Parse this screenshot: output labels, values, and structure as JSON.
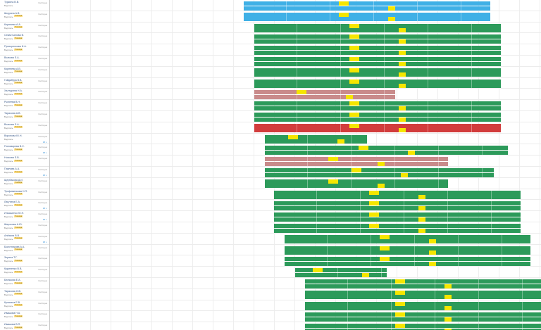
{
  "rows": [
    {
      "name": "Туркина В.В.",
      "sub": "Водитель",
      "badge": "",
      "status": "Свободна",
      "pct": "",
      "color": "blue"
    },
    {
      "name": "Шкурина А.В.",
      "sub": "Водитель",
      "badge": "Ученица",
      "status": "Свободна",
      "pct": "",
      "color": "blue"
    },
    {
      "name": "Корнеева А.А.",
      "sub": "Водитель",
      "badge": "Ученица",
      "status": "Свободна",
      "pct": "",
      "color": "green"
    },
    {
      "name": "Севастьянова В.",
      "sub": "Водитель",
      "badge": "Ученица",
      "status": "Свободна",
      "pct": "",
      "color": "green"
    },
    {
      "name": "Прохоренкова И.А.",
      "sub": "Водитель",
      "badge": "Ученица",
      "status": "Свободна",
      "pct": "",
      "color": "green"
    },
    {
      "name": "Волкова Е.А.",
      "sub": "Водитель",
      "badge": "Ученица",
      "status": "Свободна",
      "pct": "",
      "color": "green"
    },
    {
      "name": "Корнеева А.В.",
      "sub": "Водитель",
      "badge": "Ученица",
      "status": "Свободна",
      "pct": "",
      "color": "green"
    },
    {
      "name": "Гайдабура В.В.",
      "sub": "Водитель",
      "badge": "Ученица",
      "status": "Свободна",
      "pct": "",
      "color": "green"
    },
    {
      "name": "Халтурина Н.А.",
      "sub": "Водитель",
      "badge": "Ученица",
      "status": "Свободна",
      "pct": "",
      "color": "pink"
    },
    {
      "name": "Рылеева В.Н.",
      "sub": "Водитель",
      "badge": "Ученица",
      "status": "Свободна",
      "pct": "",
      "color": "green"
    },
    {
      "name": "Тарасова А.В.",
      "sub": "Водитель",
      "badge": "Ученица",
      "status": "Свободна",
      "pct": "",
      "color": "green"
    },
    {
      "name": "Волкова Л.А.",
      "sub": "Водитель",
      "badge": "Ученица",
      "status": "Свободна",
      "pct": "",
      "color": "red"
    },
    {
      "name": "Воронова Ю.Н.",
      "sub": "Водитель",
      "badge": "",
      "status": "Свободна",
      "pct": "48 ч.",
      "color": "green"
    },
    {
      "name": "Пономарева В.С.",
      "sub": "Водитель",
      "badge": "Ученица",
      "status": "Свободна",
      "pct": "48 ч.",
      "color": "green"
    },
    {
      "name": "Носкова Е.В.",
      "sub": "Водитель",
      "badge": "Ученица",
      "status": "Свободна",
      "pct": "",
      "color": "pink"
    },
    {
      "name": "Павлова А.А.",
      "sub": "Водитель",
      "badge": "Ученица",
      "status": "Свободна",
      "pct": "48 ч.",
      "color": "green"
    },
    {
      "name": "Щербакова Д.И.",
      "sub": "Водитель",
      "badge": "Ученица",
      "status": "Свободна",
      "pct": "",
      "color": "green"
    },
    {
      "name": "Трофименкова Н.П.",
      "sub": "Водитель",
      "badge": "Ученица",
      "status": "Свободна",
      "pct": "",
      "color": "green"
    },
    {
      "name": "Лагутина Е.А.",
      "sub": "Водитель",
      "badge": "Ученица",
      "status": "Свободна",
      "pct": "48 ч.",
      "color": "green"
    },
    {
      "name": "Ильяшенко Ю.Н.",
      "sub": "Водитель",
      "badge": "Ученица",
      "status": "Свободна",
      "pct": "48 ч.",
      "color": "green"
    },
    {
      "name": "Широкова А.Ю.",
      "sub": "Водитель",
      "badge": "Ученица",
      "status": "Свободна",
      "pct": "",
      "color": "green"
    },
    {
      "name": "Алёхина В.В.",
      "sub": "Водитель",
      "badge": "Ученица",
      "status": "Свободна",
      "pct": "48 ч.",
      "color": "green"
    },
    {
      "name": "Болотникова А.А.",
      "sub": "Водитель",
      "badge": "Ученица",
      "status": "Свободна",
      "pct": "",
      "color": "green"
    },
    {
      "name": "Зерина Т.Г.",
      "sub": "Водитель",
      "badge": "Ученица",
      "status": "Свободна",
      "pct": "",
      "color": "green"
    },
    {
      "name": "Куриленко В.В.",
      "sub": "Водитель",
      "badge": "Ученица",
      "status": "Свободна",
      "pct": "",
      "color": "green"
    },
    {
      "name": "Белякова Е.А.",
      "sub": "Водитель",
      "badge": "Ученица",
      "status": "Свободна",
      "pct": "",
      "color": "green"
    },
    {
      "name": "Тарасова О.В.",
      "sub": "Водитель",
      "badge": "Ученица",
      "status": "Свободна",
      "pct": "",
      "color": "green"
    },
    {
      "name": "Кулагина Е.В.",
      "sub": "Водитель",
      "badge": "Ученица",
      "status": "Свободна",
      "pct": "",
      "color": "green"
    },
    {
      "name": "Ивашова Н.А.",
      "sub": "Водитель",
      "badge": "Ученица",
      "status": "Свободна",
      "pct": "",
      "color": "green"
    },
    {
      "name": "Ивашова В.П.",
      "sub": "Водитель",
      "badge": "Ученица",
      "status": "Свободна",
      "pct": "",
      "color": "green"
    }
  ],
  "colors": {
    "blue": "#3fb0e6",
    "green": "#2c9a5a",
    "red": "#d23c3c",
    "pink": "#c98b8b",
    "yellow": "#f5e600",
    "grid": "#eeeeee"
  }
}
